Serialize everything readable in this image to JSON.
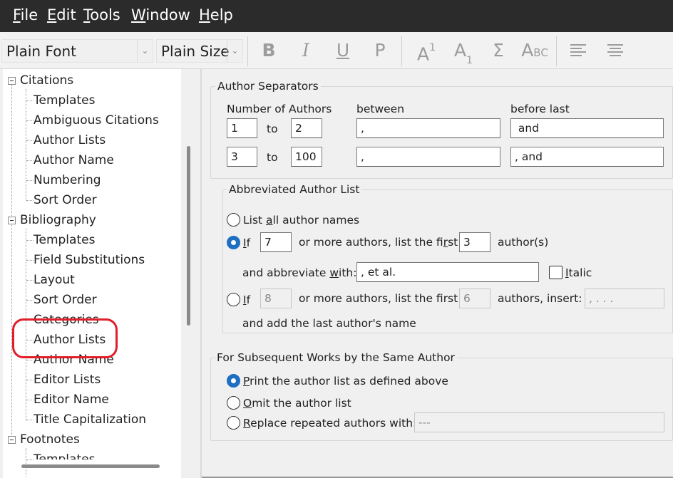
{
  "menu": [
    {
      "pre": "",
      "key": "F",
      "post": "ile"
    },
    {
      "pre": "",
      "key": "E",
      "post": "dit"
    },
    {
      "pre": "",
      "key": "T",
      "post": "ools"
    },
    {
      "pre": "",
      "key": "W",
      "post": "indow"
    },
    {
      "pre": "",
      "key": "H",
      "post": "elp"
    }
  ],
  "toolbar": {
    "font_value": "Plain Font",
    "size_value": "Plain Size",
    "bold": "B",
    "italic": "I",
    "underline": "U",
    "plain": "P",
    "superscript": "A",
    "superscript_mark": "1",
    "subscript": "A",
    "subscript_mark": "1",
    "symbol": "Σ",
    "smallcaps_big": "A",
    "smallcaps_small": "BC"
  },
  "tree": {
    "citations": {
      "label": "Citations",
      "children": [
        "Templates",
        "Ambiguous Citations",
        "Author Lists",
        "Author Name",
        "Numbering",
        "Sort Order"
      ]
    },
    "bibliography": {
      "label": "Bibliography",
      "children": [
        "Templates",
        "Field Substitutions",
        "Layout",
        "Sort Order",
        "Categories",
        "Author Lists",
        "Author Name",
        "Editor Lists",
        "Editor Name",
        "Title Capitalization"
      ]
    },
    "footnotes": {
      "label": "Footnotes",
      "children": [
        "Templates"
      ]
    }
  },
  "separators": {
    "title": "Author Separators",
    "col_number": "Number of Authors",
    "col_between": "between",
    "col_before_last": "before last",
    "to_label": "to",
    "rows": [
      {
        "from": "1",
        "to": "2",
        "between": ",",
        "before_last": " and"
      },
      {
        "from": "3",
        "to": "100",
        "between": ",",
        "before_last": ", and"
      }
    ]
  },
  "abbrev": {
    "title": "Abbreviated Author List",
    "opt_list_all": {
      "pre": "List ",
      "key": "a",
      "post": "ll author names"
    },
    "if_label": {
      "pre": "",
      "key": "I",
      "post": "f"
    },
    "or_more_label": "or more authors, list the fi",
    "or_more_key": "r",
    "or_more_post": "st",
    "authors_suffix": "author(s)",
    "abbreviate_label_pre": "and abbreviate ",
    "abbreviate_label_key": "w",
    "abbreviate_label_post": "ith:",
    "if_value": "7",
    "first_value": "3",
    "abbreviate_value": ", et al.",
    "italic_label": {
      "pre": "",
      "key": "I",
      "post": "talic"
    },
    "if2_label": {
      "pre": "",
      "key": "I",
      "post": "f"
    },
    "or_more2_label": "or more authors, list the first",
    "insert_label": "authors, insert:",
    "if2_value": "8",
    "first2_value": "6",
    "insert_value": ", . . .",
    "last_author_label": "and add the last author's name"
  },
  "subsequent": {
    "title": "For Subsequent Works by the Same Author",
    "opt_print": {
      "pre": "",
      "key": "P",
      "post": "rint the author list as defined above"
    },
    "opt_omit": {
      "pre": "",
      "key": "O",
      "post": "mit the author list"
    },
    "opt_replace": {
      "pre": "",
      "key": "R",
      "post": "eplace repeated authors with:"
    },
    "replace_value": "---"
  },
  "colors": {
    "menubar_bg": "#2b2b2b",
    "radio_selected": "#1f6fc2",
    "highlight_circle": "#e01f2a"
  }
}
